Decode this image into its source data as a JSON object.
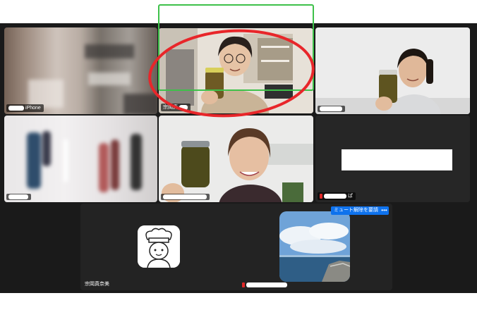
{
  "tiles": [
    {
      "name_visible": "iPhone",
      "muted": false
    },
    {
      "name_visible": "宗岡真",
      "muted": false
    },
    {
      "name_visible": "",
      "muted": false
    },
    {
      "name_visible": "",
      "muted": false
    },
    {
      "name_visible": "",
      "muted": false
    },
    {
      "name_visible": "ぱ",
      "muted": true
    },
    {
      "name_visible": "宗岡真奈美",
      "muted": false
    },
    {
      "name_visible": "",
      "muted": true
    }
  ],
  "hover_controls": {
    "unmute_label": "ミュート解除を要請",
    "more_label": "•••"
  },
  "colors": {
    "active_speaker_border": "#3ec14a",
    "annotation_circle": "#e8262a",
    "button_blue": "#0e72ed",
    "muted_red": "#e02828"
  },
  "icons": {
    "chef_avatar": "chef-avatar-icon",
    "sea_avatar": "seaside-avatar-image",
    "more": "ellipsis-icon",
    "mute": "muted-mic-icon"
  }
}
